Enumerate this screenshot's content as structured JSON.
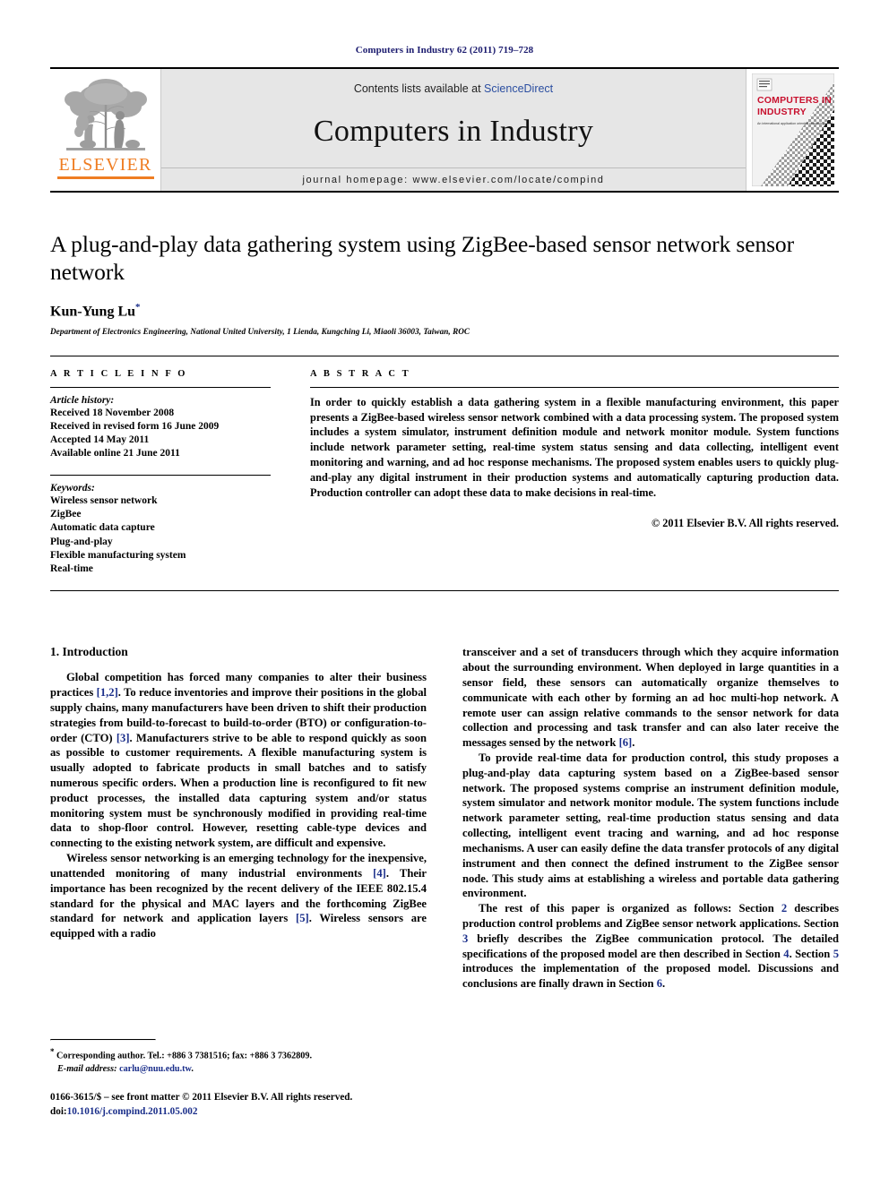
{
  "running_head": "Computers in Industry 62 (2011) 719–728",
  "masthead": {
    "contents_prefix": "Contents lists available at ",
    "sciencedirect": "ScienceDirect",
    "journal_name": "Computers in Industry",
    "homepage": "journal homepage: www.elsevier.com/locate/compind",
    "publisher_logo_text": "ELSEVIER",
    "cover_title_line1": "COMPUTERS IN",
    "cover_title_line2": "INDUSTRY",
    "cover_subtitle": "An international application oriented research journal",
    "accent_orange": "#ef7d22",
    "cover_red": "#c8102e",
    "link_blue": "#2b4ea0"
  },
  "title": "A plug-and-play data gathering system using ZigBee-based sensor network sensor network",
  "authors": "Kun-Yung Lu",
  "author_marker": "*",
  "affiliation": "Department of Electronics Engineering, National United University, 1 Lienda, Kungching Li, Miaoli 36003, Taiwan, ROC",
  "article_info": {
    "heading": "A R T I C L E  I N F O",
    "history_label": "Article history:",
    "history": [
      "Received 18 November 2008",
      "Received in revised form 16 June 2009",
      "Accepted 14 May 2011",
      "Available online 21 June 2011"
    ],
    "keywords_label": "Keywords:",
    "keywords": [
      "Wireless sensor network",
      "ZigBee",
      "Automatic data capture",
      "Plug-and-play",
      "Flexible manufacturing system",
      "Real-time"
    ]
  },
  "abstract": {
    "heading": "A B S T R A C T",
    "text": "In order to quickly establish a data gathering system in a flexible manufacturing environment, this paper presents a ZigBee-based wireless sensor network combined with a data processing system. The proposed system includes a system simulator, instrument definition module and network monitor module. System functions include network parameter setting, real-time system status sensing and data collecting, intelligent event monitoring and warning, and ad hoc response mechanisms. The proposed system enables users to quickly plug-and-play any digital instrument in their production systems and automatically capturing production data. Production controller can adopt these data to make decisions in real-time.",
    "copyright": "© 2011 Elsevier B.V. All rights reserved."
  },
  "body": {
    "section_title": "1.  Introduction",
    "left_paragraphs": [
      {
        "parts": [
          {
            "t": "Global competition has forced many companies to alter their business practices "
          },
          {
            "t": "[1,2]",
            "link": true
          },
          {
            "t": ". To reduce inventories and improve their positions in the global supply chains, many manufacturers have been driven to shift their production strategies from build-to-forecast to build-to-order (BTO) or configuration-to-order (CTO) "
          },
          {
            "t": "[3]",
            "link": true
          },
          {
            "t": ". Manufacturers strive to be able to respond quickly as soon as possible to customer requirements. A flexible manufacturing system is usually adopted to fabricate products in small batches and to satisfy numerous specific orders. When a production line is reconfigured to fit new product processes, the installed data capturing system and/or status monitoring system must be synchronously modified in providing real-time data to shop-floor control. However, resetting cable-type devices and connecting to the existing network system, are difficult and expensive."
          }
        ]
      },
      {
        "parts": [
          {
            "t": "Wireless sensor networking is an emerging technology for the inexpensive, unattended monitoring of many industrial environments "
          },
          {
            "t": "[4]",
            "link": true
          },
          {
            "t": ". Their importance has been recognized by the recent delivery of the IEEE 802.15.4 standard for the physical and MAC layers and the forthcoming ZigBee standard for network and application layers "
          },
          {
            "t": "[5]",
            "link": true
          },
          {
            "t": ". Wireless sensors are equipped with a radio"
          }
        ]
      }
    ],
    "right_paragraphs": [
      {
        "continued": true,
        "parts": [
          {
            "t": "transceiver and a set of transducers through which they acquire information about the surrounding environment. When deployed in large quantities in a sensor field, these sensors can automatically organize themselves to communicate with each other by forming an ad hoc multi-hop network. A remote user can assign relative commands to the sensor network for data collection and processing and task transfer and can also later receive the messages sensed by the network "
          },
          {
            "t": "[6]",
            "link": true
          },
          {
            "t": "."
          }
        ]
      },
      {
        "parts": [
          {
            "t": "To provide real-time data for production control, this study proposes a plug-and-play data capturing system based on a ZigBee-based sensor network. The proposed systems comprise an instrument definition module, system simulator and network monitor module. The system functions include network parameter setting, real-time production status sensing and data collecting, intelligent event tracing and warning, and ad hoc response mechanisms. A user can easily define the data transfer protocols of any digital instrument and then connect the defined instrument to the ZigBee sensor node. This study aims at establishing a wireless and portable data gathering environment."
          }
        ]
      },
      {
        "parts": [
          {
            "t": "The rest of this paper is organized as follows: Section "
          },
          {
            "t": "2",
            "link": true
          },
          {
            "t": " describes production control problems and ZigBee sensor network applications. Section "
          },
          {
            "t": "3",
            "link": true
          },
          {
            "t": " briefly describes the ZigBee communication protocol. The detailed specifications of the proposed model are then described in Section "
          },
          {
            "t": "4",
            "link": true
          },
          {
            "t": ". Section "
          },
          {
            "t": "5",
            "link": true
          },
          {
            "t": " introduces the implementation of the proposed model. Discussions and conclusions are finally drawn in Section "
          },
          {
            "t": "6",
            "link": true
          },
          {
            "t": "."
          }
        ]
      }
    ]
  },
  "footnote": {
    "marker": "*",
    "corresponding": "Corresponding author. Tel.: +886 3 7381516; fax: +886 3 7362809.",
    "email_label": "E-mail address:",
    "email": "carlu@nuu.edu.tw",
    "email_trail": "."
  },
  "imprint": {
    "line1": "0166-3615/$ – see front matter © 2011 Elsevier B.V. All rights reserved.",
    "doi_label": "doi:",
    "doi": "10.1016/j.compind.2011.05.002"
  }
}
